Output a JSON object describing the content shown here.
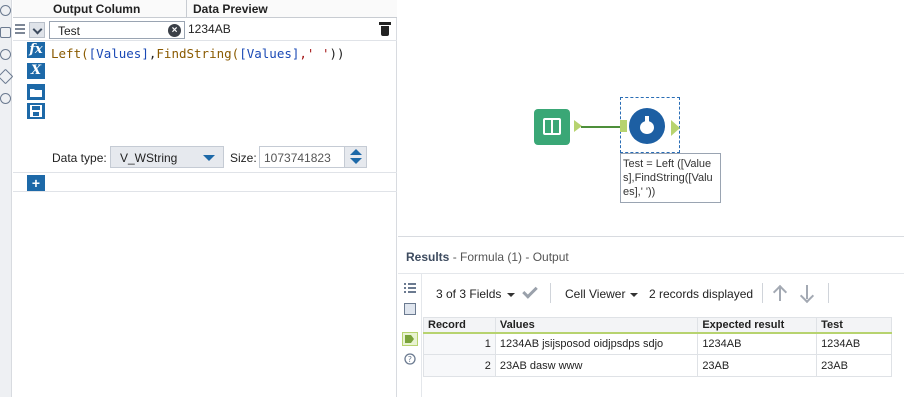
{
  "config": {
    "headers": {
      "output_column": "Output Column",
      "data_preview": "Data Preview"
    },
    "row": {
      "output_value": "Test",
      "preview_value": "1234AB"
    },
    "expression": {
      "fn1": "Left(",
      "fld1": "[Values]",
      "comma": ",",
      "fn2": "FindString(",
      "fld2": "[Values]",
      "arg": ",' '",
      "close": "))"
    },
    "data_type_label": "Data type:",
    "data_type_value": "V_WString",
    "size_label": "Size:",
    "size_value": "1073741823",
    "add_label": "+",
    "tool_icons": {
      "fx": "fx",
      "x": "X"
    }
  },
  "canvas": {
    "annotation": "Test = Left ([Values],FindString([Values],' '))"
  },
  "results": {
    "title": "Results",
    "subtitle": " - Formula (1) - Output",
    "fields_label": "3 of 3 Fields",
    "cell_viewer": "Cell Viewer",
    "records_displayed": "2 records displayed",
    "columns": [
      "Record",
      "Values",
      "Expected result",
      "Test"
    ],
    "rows": [
      [
        "1",
        "1234AB jsijsposod oidjpsdps sdjo",
        "1234AB",
        "1234AB"
      ],
      [
        "2",
        "23AB dasw www",
        "23AB",
        "23AB"
      ]
    ]
  },
  "colors": {
    "accent": "#1d69a8",
    "anchor_green": "#b7d36f",
    "input_tool": "#3aa776"
  }
}
